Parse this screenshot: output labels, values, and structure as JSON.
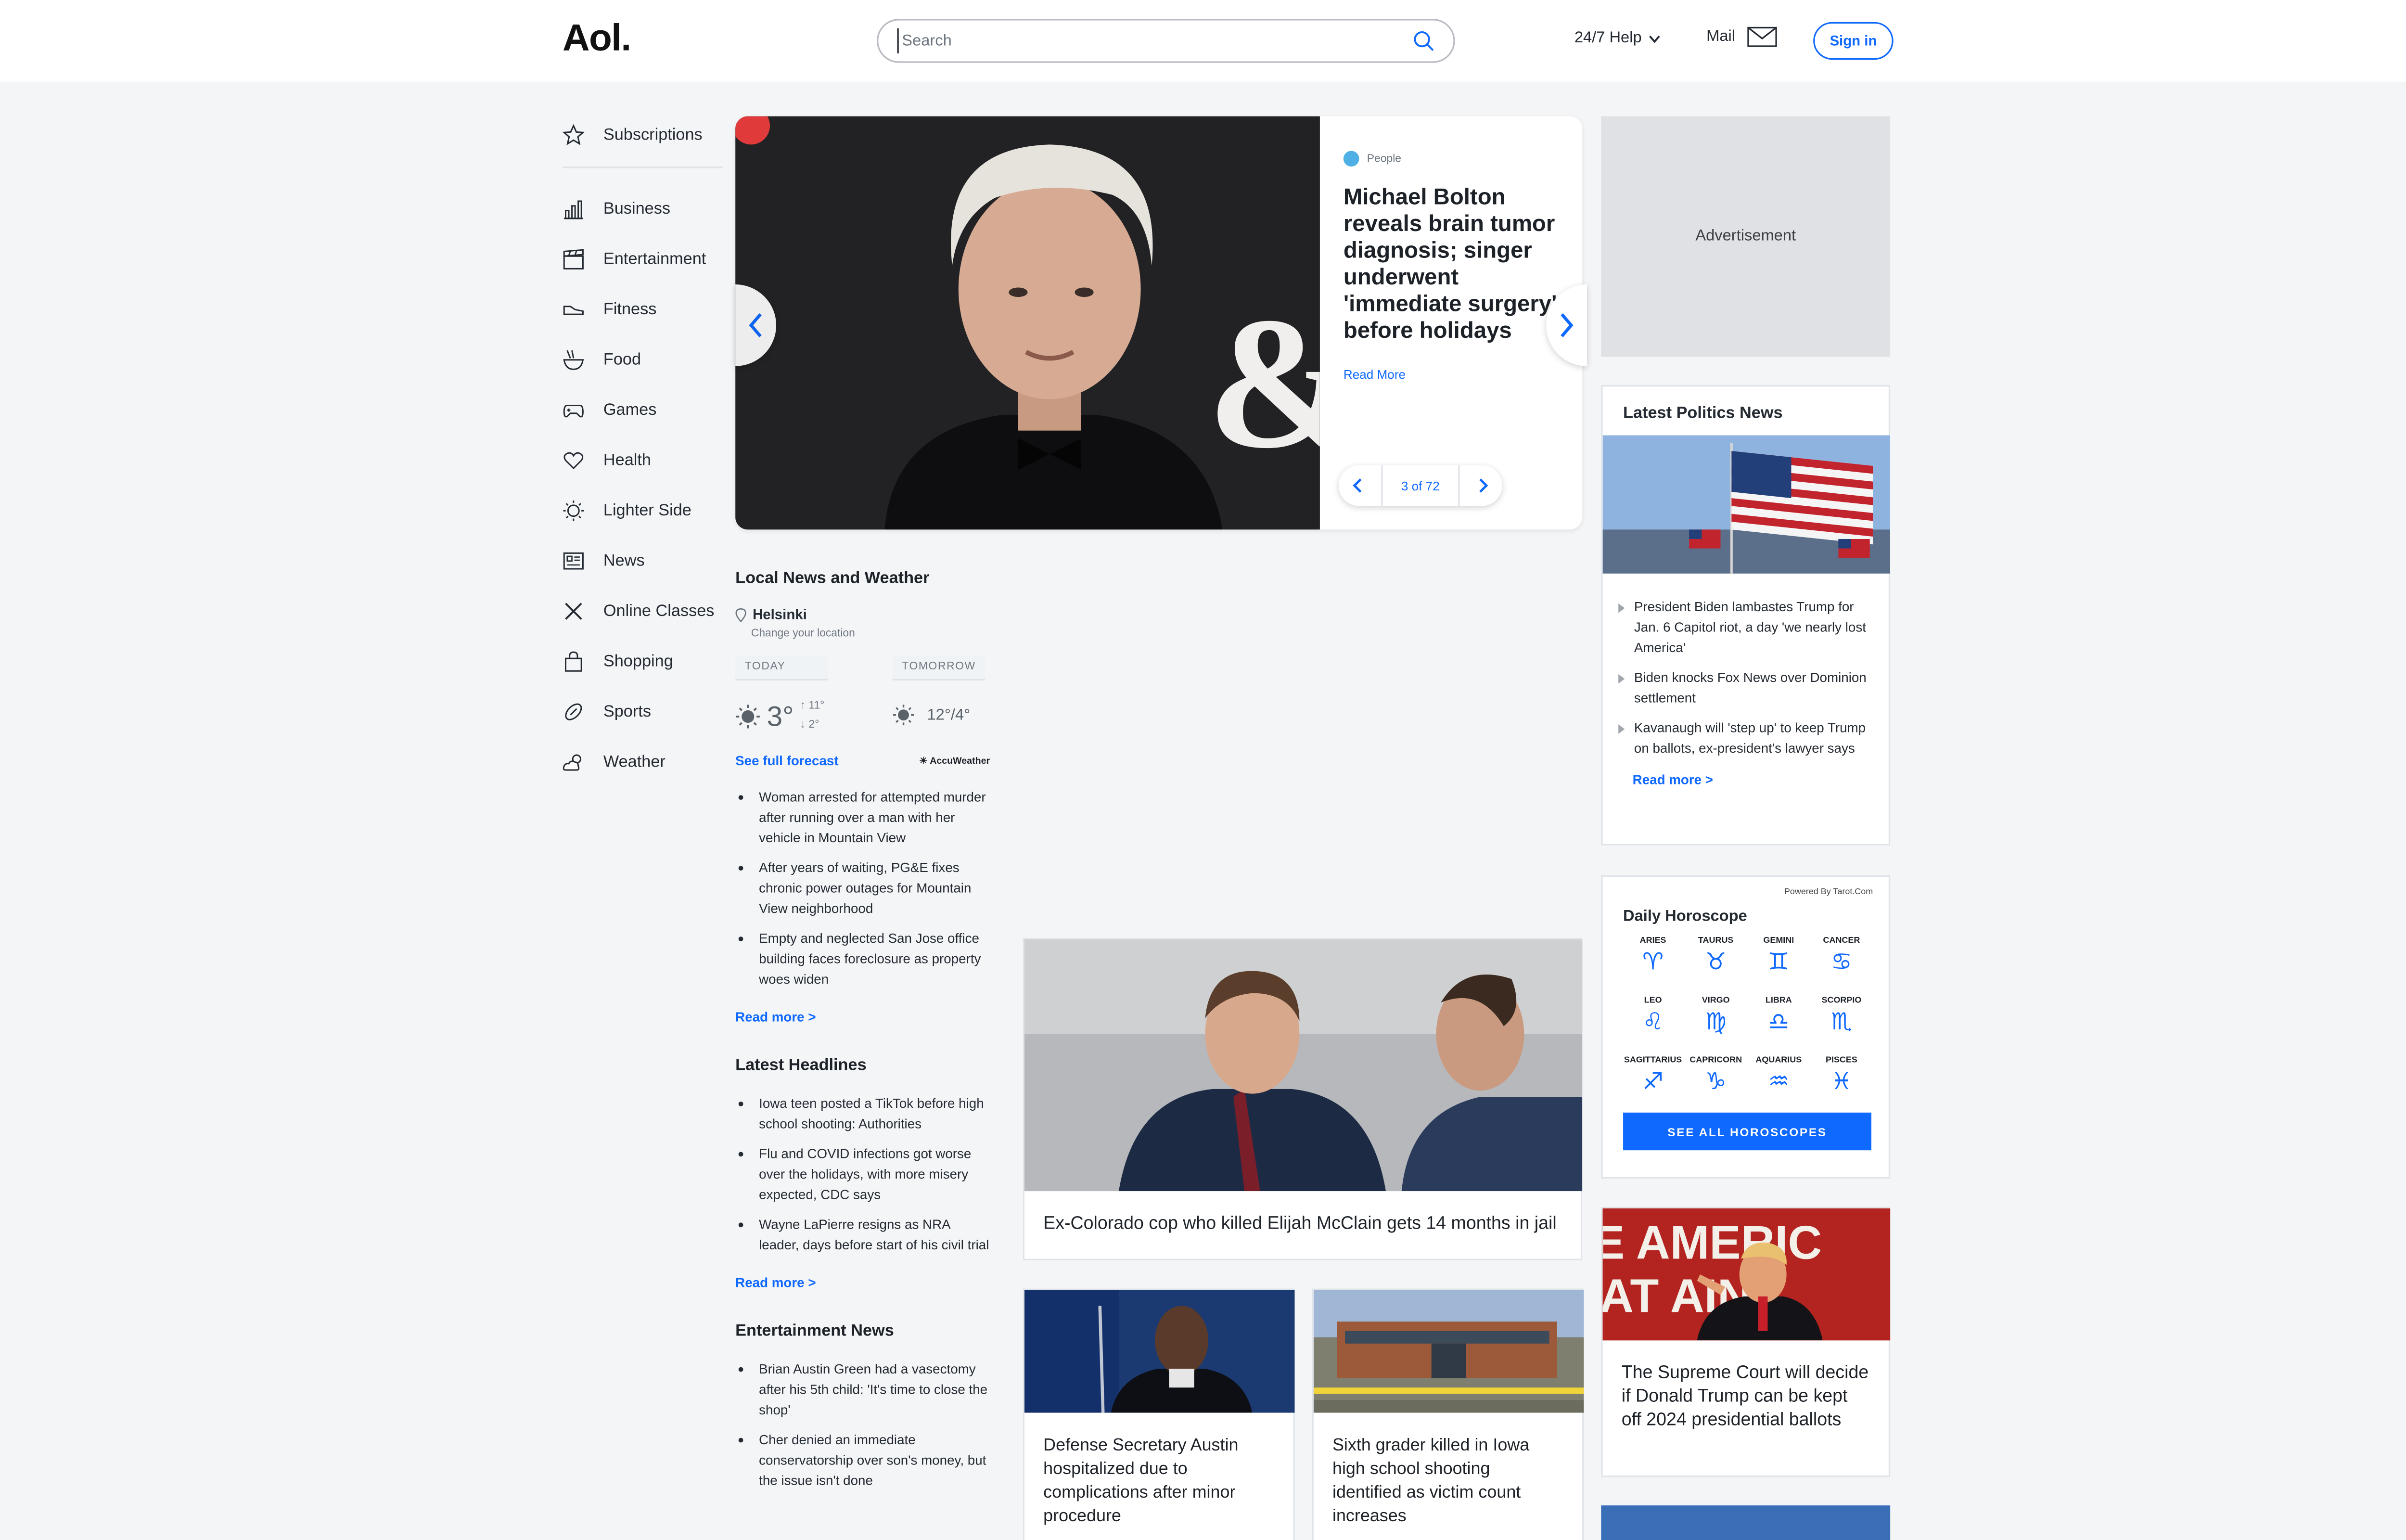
{
  "header": {
    "logo": "Aol.",
    "search_placeholder": "Search",
    "help_label": "24/7 Help",
    "mail_label": "Mail",
    "signin_label": "Sign in"
  },
  "sidebar": {
    "subscriptions": "Subscriptions",
    "items": [
      "Business",
      "Entertainment",
      "Fitness",
      "Food",
      "Games",
      "Health",
      "Lighter Side",
      "News",
      "Online Classes",
      "Shopping",
      "Sports",
      "Weather"
    ]
  },
  "hero": {
    "source": "People",
    "title": "Michael Bolton reveals brain tumor diagnosis; singer underwent 'immediate surgery' before holidays",
    "read_more": "Read More",
    "pager": "3 of 72",
    "image_text": "& OKE"
  },
  "local": {
    "title": "Local News and Weather",
    "city": "Helsinki",
    "change_location": "Change your location",
    "today_label": "TODAY",
    "tomorrow_label": "TOMORROW",
    "today_temp": "3°",
    "today_high": "11°",
    "today_low": "2°",
    "tomorrow_temp": "12°/4°",
    "forecast_link": "See full forecast",
    "accuweather": "AccuWeather",
    "news": [
      "Woman arrested for attempted murder after running over a man with her vehicle in Mountain View",
      "After years of waiting, PG&E fixes chronic power outages for Mountain View neighborhood",
      "Empty and neglected San Jose office building faces foreclosure as property woes widen"
    ],
    "read_more": "Read more >"
  },
  "headlines": {
    "title": "Latest Headlines",
    "items": [
      "Iowa teen posted a TikTok before high school shooting: Authorities",
      "Flu and COVID infections got worse over the holidays, with more misery expected, CDC says",
      "Wayne LaPierre resigns as NRA leader, days before start of his civil trial"
    ],
    "read_more": "Read more >"
  },
  "entertainment": {
    "title": "Entertainment News",
    "items": [
      "Brian Austin Green had a vasectomy after his 5th child: 'It's time to close the shop'",
      "Cher denied an immediate conservatorship over son's money, but the issue isn't done"
    ]
  },
  "stories": {
    "main": "Ex-Colorado cop who killed Elijah McClain gets 14 months in jail",
    "left": "Defense Secretary Austin hospitalized due to complications after minor procedure",
    "right": "Sixth grader killed in Iowa high school shooting identified as victim count increases"
  },
  "ad_label": "Advertisement",
  "politics": {
    "title": "Latest Politics News",
    "items": [
      "President Biden lambastes Trump for Jan. 6 Capitol riot, a day 'we nearly lost America'",
      "Biden knocks Fox News over Dominion settlement",
      "Kavanaugh will 'step up' to keep Trump on ballots, ex-president's lawyer says"
    ],
    "read_more": "Read more >"
  },
  "horoscope": {
    "powered": "Powered By Tarot.Com",
    "title": "Daily Horoscope",
    "signs": [
      {
        "name": "ARIES",
        "glyph": "♈"
      },
      {
        "name": "TAURUS",
        "glyph": "♉"
      },
      {
        "name": "GEMINI",
        "glyph": "♊"
      },
      {
        "name": "CANCER",
        "glyph": "♋"
      },
      {
        "name": "LEO",
        "glyph": "♌"
      },
      {
        "name": "VIRGO",
        "glyph": "♍"
      },
      {
        "name": "LIBRA",
        "glyph": "♎"
      },
      {
        "name": "SCORPIO",
        "glyph": "♏"
      },
      {
        "name": "SAGITTARIUS",
        "glyph": "♐"
      },
      {
        "name": "CAPRICORN",
        "glyph": "♑"
      },
      {
        "name": "AQUARIUS",
        "glyph": "♒"
      },
      {
        "name": "PISCES",
        "glyph": "♓"
      }
    ],
    "button": "SEE ALL HOROSCOPES"
  },
  "trump_story": {
    "image_text": "E AMERIC AT AIN",
    "caption": "The Supreme Court will decide if Donald Trump can be kept off 2024 presidential ballots"
  },
  "colors": {
    "accent": "#0f69ff",
    "text": "#232a31",
    "ad_bg": "#dfe1e4"
  }
}
